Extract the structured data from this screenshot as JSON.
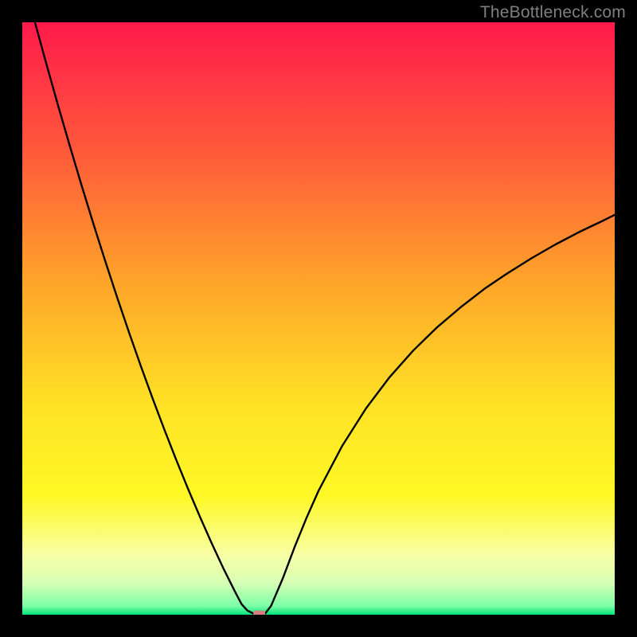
{
  "watermark": "TheBottleneck.com",
  "chart_data": {
    "type": "line",
    "title": "",
    "xlabel": "",
    "ylabel": "",
    "xlim": [
      0,
      100
    ],
    "ylim": [
      0,
      100
    ],
    "grid": false,
    "legend": false,
    "background_gradient": {
      "stops": [
        {
          "offset": 0.0,
          "color": "#ff1a4b"
        },
        {
          "offset": 0.22,
          "color": "#ff5a3a"
        },
        {
          "offset": 0.45,
          "color": "#ffa829"
        },
        {
          "offset": 0.65,
          "color": "#ffe326"
        },
        {
          "offset": 0.8,
          "color": "#fff826"
        },
        {
          "offset": 0.9,
          "color": "#f8ffa6"
        },
        {
          "offset": 0.945,
          "color": "#d8ffb5"
        },
        {
          "offset": 0.985,
          "color": "#7fffa8"
        },
        {
          "offset": 1.0,
          "color": "#00e47a"
        }
      ]
    },
    "series": [
      {
        "name": "bottleneck-curve",
        "color": "#000000",
        "width": 2.4,
        "x": [
          0,
          2,
          4,
          6,
          8,
          10,
          12,
          14,
          16,
          18,
          20,
          22,
          24,
          26,
          28,
          30,
          32,
          34,
          36,
          37,
          38,
          39,
          39.8,
          41,
          42,
          44,
          46,
          48,
          50,
          54,
          58,
          62,
          66,
          70,
          74,
          78,
          82,
          86,
          90,
          94,
          98,
          100
        ],
        "y": [
          108,
          100.5,
          93.2,
          86.1,
          79.2,
          72.5,
          66.0,
          59.7,
          53.6,
          47.7,
          42.0,
          36.5,
          31.2,
          26.1,
          21.2,
          16.5,
          12.0,
          7.7,
          3.7,
          1.8,
          0.7,
          0.2,
          0.0,
          0.2,
          1.5,
          6.2,
          11.5,
          16.4,
          20.9,
          28.5,
          34.8,
          40.1,
          44.6,
          48.5,
          51.9,
          55.0,
          57.7,
          60.2,
          62.5,
          64.6,
          66.5,
          67.5
        ]
      }
    ],
    "marker": {
      "x": 40.0,
      "y": 0.2,
      "w": 2.0,
      "h": 1.0,
      "color": "#d77d7d"
    }
  }
}
